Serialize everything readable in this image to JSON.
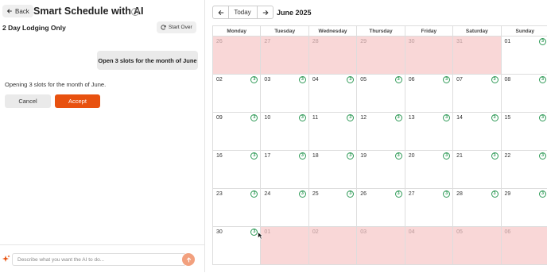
{
  "header": {
    "back_label": "Back",
    "title": "Smart Schedule with AI",
    "subtitle": "2 Day Lodging Only",
    "start_over_label": "Start Over"
  },
  "chat": {
    "user_message": "Open 3 slots for the month of June",
    "ai_message": "Opening 3 slots for the month of June.",
    "cancel_label": "Cancel",
    "accept_label": "Accept",
    "input_placeholder": "Describe what you want the AI to do..."
  },
  "calendar": {
    "today_label": "Today",
    "month_label": "June 2025",
    "weekdays": [
      "Monday",
      "Tuesday",
      "Wednesday",
      "Thursday",
      "Friday",
      "Saturday",
      "Sunday"
    ],
    "weeks": [
      [
        {
          "d": "26",
          "o": true
        },
        {
          "d": "27",
          "o": true
        },
        {
          "d": "28",
          "o": true
        },
        {
          "d": "29",
          "o": true
        },
        {
          "d": "30",
          "o": true
        },
        {
          "d": "31",
          "o": true
        },
        {
          "d": "01",
          "o": false,
          "s": "3"
        }
      ],
      [
        {
          "d": "02",
          "o": false,
          "s": "3"
        },
        {
          "d": "03",
          "o": false,
          "s": "3"
        },
        {
          "d": "04",
          "o": false,
          "s": "3"
        },
        {
          "d": "05",
          "o": false,
          "s": "3"
        },
        {
          "d": "06",
          "o": false,
          "s": "3"
        },
        {
          "d": "07",
          "o": false,
          "s": "3"
        },
        {
          "d": "08",
          "o": false,
          "s": "3"
        }
      ],
      [
        {
          "d": "09",
          "o": false,
          "s": "3"
        },
        {
          "d": "10",
          "o": false,
          "s": "3"
        },
        {
          "d": "11",
          "o": false,
          "s": "3"
        },
        {
          "d": "12",
          "o": false,
          "s": "3"
        },
        {
          "d": "13",
          "o": false,
          "s": "3"
        },
        {
          "d": "14",
          "o": false,
          "s": "3"
        },
        {
          "d": "15",
          "o": false,
          "s": "3"
        }
      ],
      [
        {
          "d": "16",
          "o": false,
          "s": "3"
        },
        {
          "d": "17",
          "o": false,
          "s": "3"
        },
        {
          "d": "18",
          "o": false,
          "s": "3"
        },
        {
          "d": "19",
          "o": false,
          "s": "3"
        },
        {
          "d": "20",
          "o": false,
          "s": "3"
        },
        {
          "d": "21",
          "o": false,
          "s": "3"
        },
        {
          "d": "22",
          "o": false,
          "s": "3"
        }
      ],
      [
        {
          "d": "23",
          "o": false,
          "s": "3"
        },
        {
          "d": "24",
          "o": false,
          "s": "3"
        },
        {
          "d": "25",
          "o": false,
          "s": "3"
        },
        {
          "d": "26",
          "o": false,
          "s": "3"
        },
        {
          "d": "27",
          "o": false,
          "s": "3"
        },
        {
          "d": "28",
          "o": false,
          "s": "3"
        },
        {
          "d": "29",
          "o": false,
          "s": "3"
        }
      ],
      [
        {
          "d": "30",
          "o": false,
          "s": "3"
        },
        {
          "d": "01",
          "o": true
        },
        {
          "d": "02",
          "o": true
        },
        {
          "d": "03",
          "o": true
        },
        {
          "d": "04",
          "o": true
        },
        {
          "d": "05",
          "o": true
        },
        {
          "d": "06",
          "o": true
        }
      ]
    ]
  },
  "colors": {
    "accent": "#e8510f",
    "slot_badge": "#2f9a57",
    "unavailable_day": "#f9d7d7"
  },
  "icons": [
    "arrow-left-icon",
    "help-circle-icon",
    "refresh-icon",
    "sparkle-icon",
    "arrow-up-icon",
    "arrow-right-icon",
    "mouse-cursor-icon"
  ]
}
